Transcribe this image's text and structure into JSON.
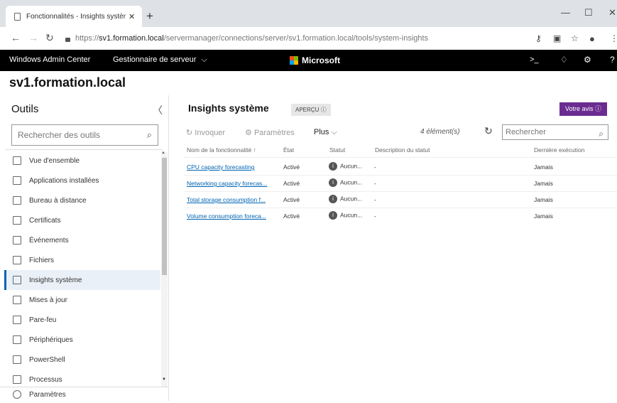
{
  "browser": {
    "tab_title": "Fonctionnalités - Insights systèm",
    "tab_close": "✕",
    "new_tab": "+",
    "url_scheme": "https://",
    "url_host": "sv1.formation.local",
    "url_path": "/servermanager/connections/server/sv1.formation.local/tools/system-insights"
  },
  "appbar": {
    "product": "Windows Admin Center",
    "menu": "Gestionnaire de serveur",
    "brand": "Microsoft",
    "brand_colors": [
      "#f25022",
      "#7fba00",
      "#00a4ef",
      "#ffb900"
    ]
  },
  "server_name": "sv1.formation.local",
  "sidebar": {
    "title": "Outils",
    "search_placeholder": "Rechercher des outils",
    "items": [
      {
        "label": "Vue d'ensemble",
        "icon": "overview-icon"
      },
      {
        "label": "Applications installées",
        "icon": "list-icon"
      },
      {
        "label": "Bureau à distance",
        "icon": "remote-desktop-icon"
      },
      {
        "label": "Certificats",
        "icon": "certificate-icon"
      },
      {
        "label": "Événements",
        "icon": "events-icon"
      },
      {
        "label": "Fichiers",
        "icon": "folder-icon"
      },
      {
        "label": "Insights système",
        "icon": "insights-icon",
        "active": true
      },
      {
        "label": "Mises à jour",
        "icon": "updates-icon"
      },
      {
        "label": "Pare-feu",
        "icon": "firewall-icon"
      },
      {
        "label": "Périphériques",
        "icon": "devices-icon"
      },
      {
        "label": "PowerShell",
        "icon": "powershell-icon"
      },
      {
        "label": "Processus",
        "icon": "process-icon"
      }
    ],
    "settings_label": "Paramètres"
  },
  "main": {
    "title": "Insights système",
    "preview_badge": "APERÇU ⓘ",
    "feedback_button": "Votre avis ⓘ",
    "toolbar": {
      "invoke": "Invoquer",
      "settings": "Paramètres",
      "more": "Plus",
      "count": "4 élément(s)",
      "search_placeholder": "Rechercher"
    },
    "columns": [
      "Nom de la fonctionnalité ↑",
      "État",
      "Statut",
      "Description du statut",
      "Dernière exécution"
    ],
    "rows": [
      {
        "name": "CPU capacity forecasting",
        "state": "Activé",
        "status": "Aucun...",
        "description": "-",
        "last_run": "Jamais"
      },
      {
        "name": "Networking capacity forecas...",
        "state": "Activé",
        "status": "Aucun...",
        "description": "-",
        "last_run": "Jamais"
      },
      {
        "name": "Total storage consumption f...",
        "state": "Activé",
        "status": "Aucun...",
        "description": "-",
        "last_run": "Jamais"
      },
      {
        "name": "Volume consumption foreca...",
        "state": "Activé",
        "status": "Aucun...",
        "description": "-",
        "last_run": "Jamais"
      }
    ]
  }
}
